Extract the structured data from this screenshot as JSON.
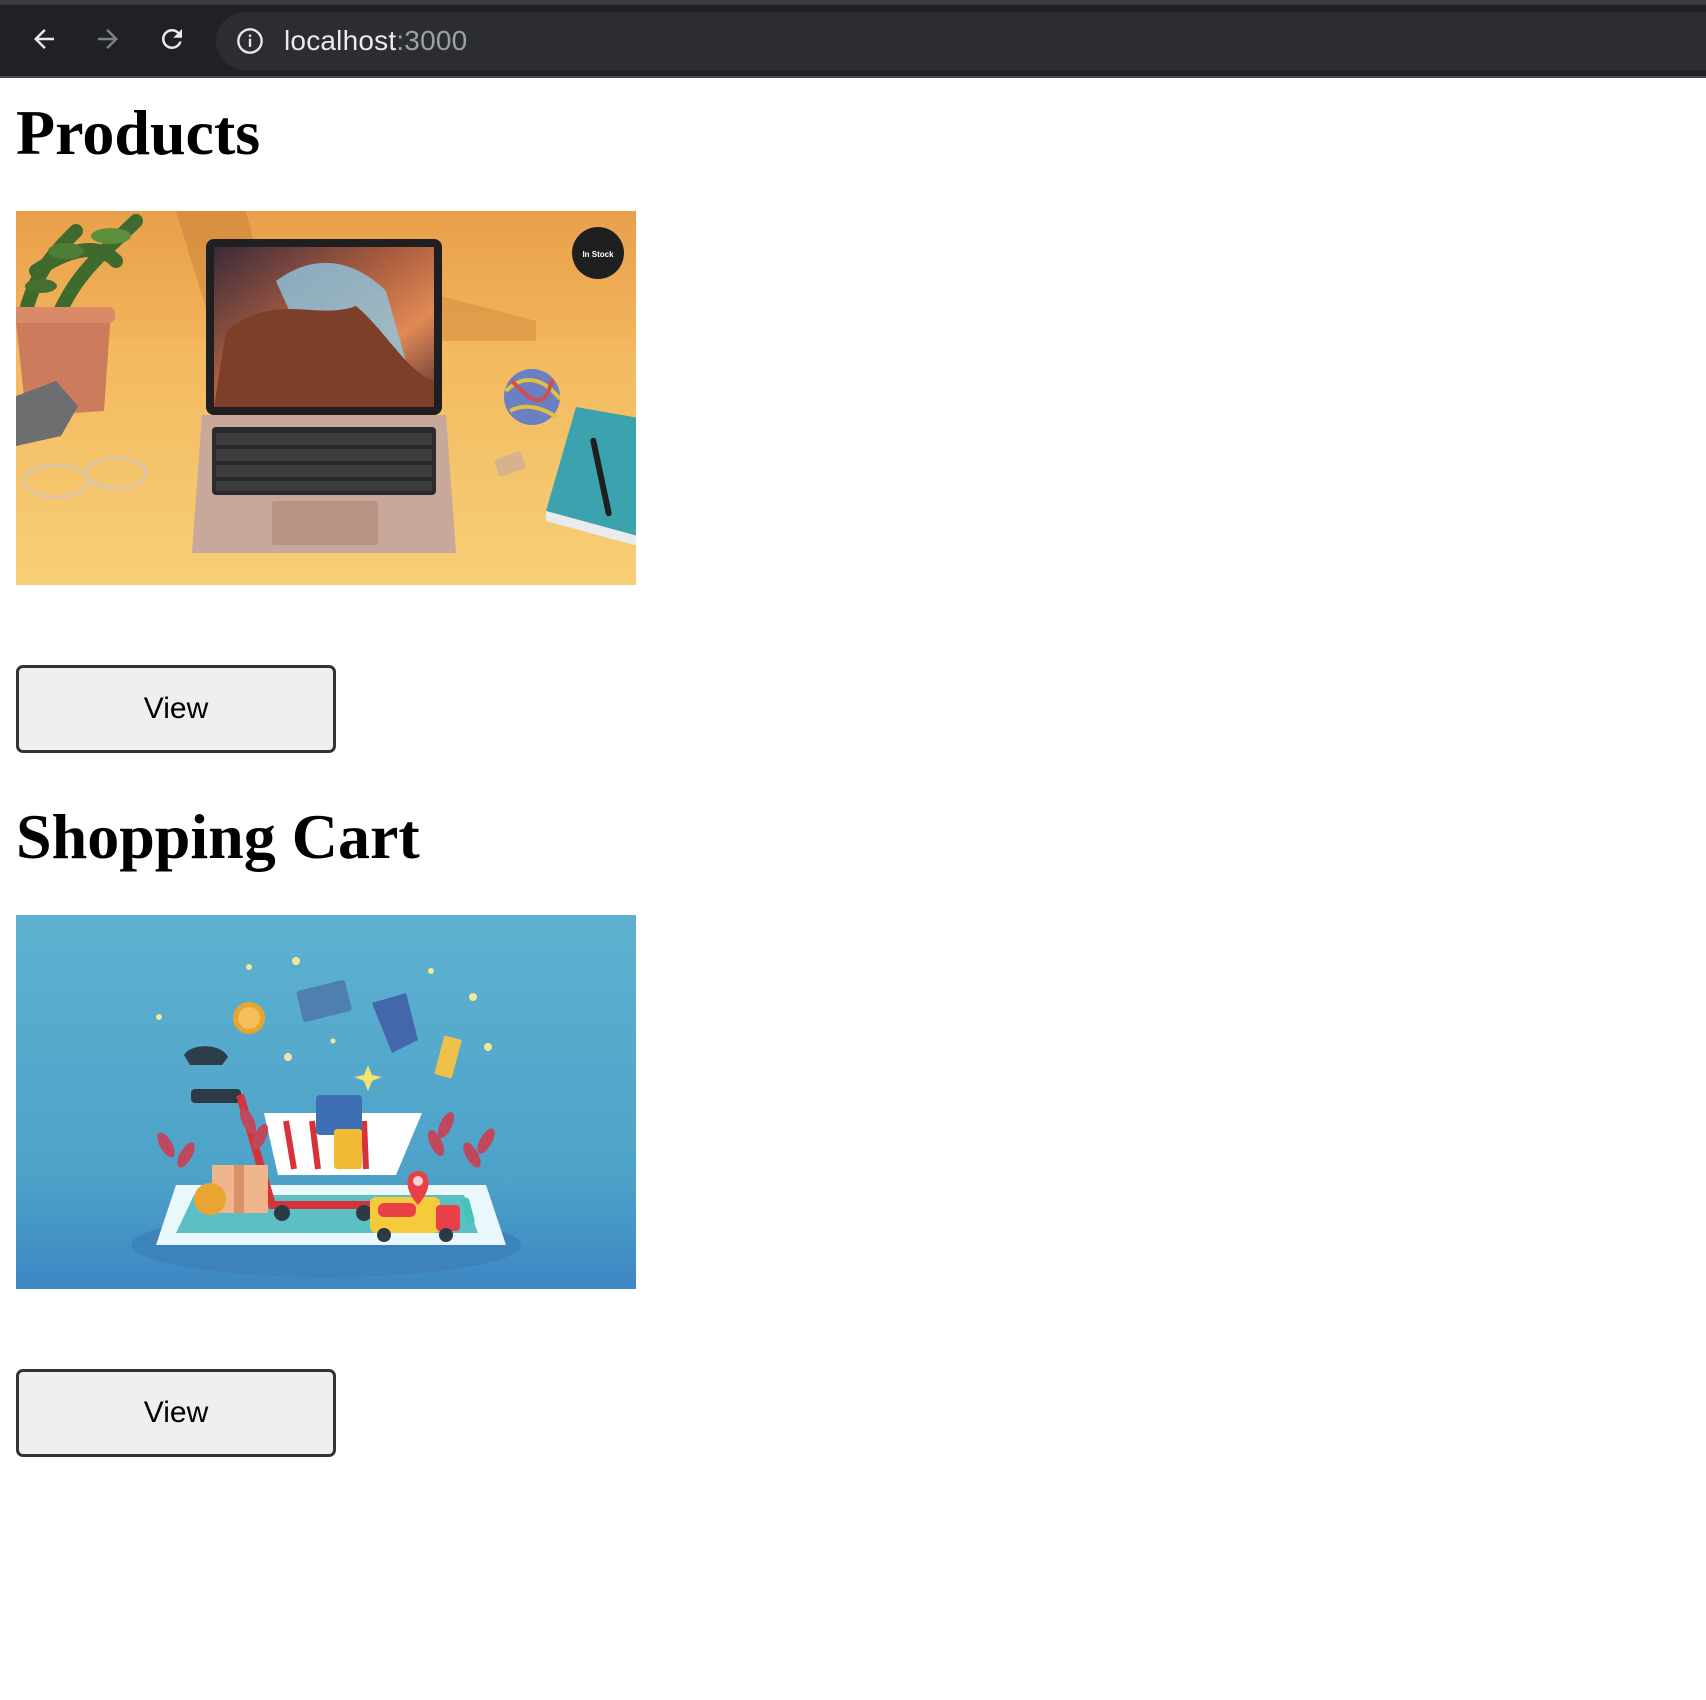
{
  "browser": {
    "url_host": "localhost",
    "url_port": ":3000",
    "icons": [
      "back-arrow-icon",
      "forward-arrow-icon",
      "reload-icon",
      "info-icon"
    ]
  },
  "sections": [
    {
      "title": "Products",
      "image": "laptop on yellow desk",
      "badge_text": "In Stock",
      "button_label": "View"
    },
    {
      "title": "Shopping Cart",
      "image": "shopping cart illustration",
      "button_label": "View"
    }
  ]
}
